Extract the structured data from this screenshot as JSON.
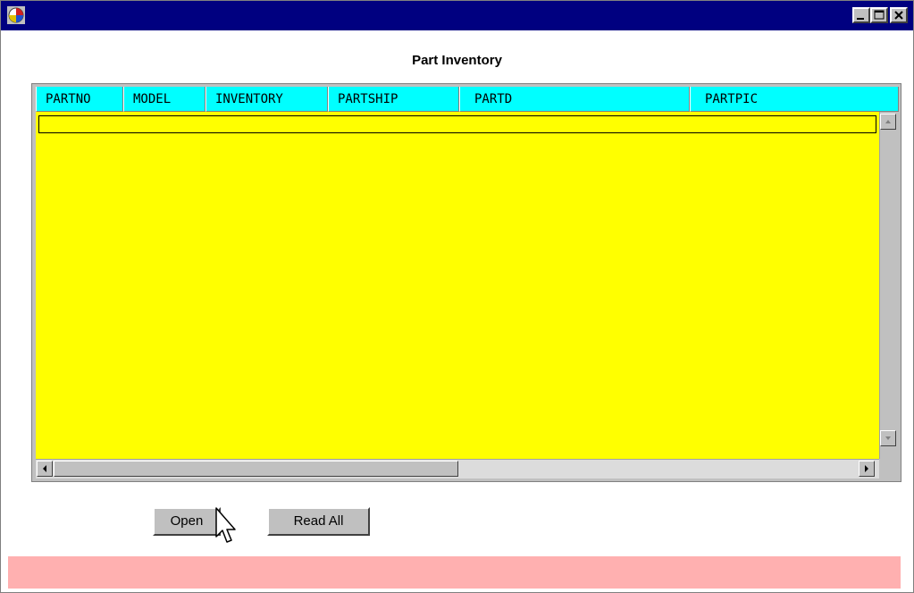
{
  "window": {
    "title": "",
    "controls": [
      "minimize-icon",
      "maximize-icon",
      "close-icon"
    ]
  },
  "heading": "Part Inventory",
  "table": {
    "columns": [
      "PARTNO",
      "MODEL",
      "INVENTORY",
      "PARTSHIP",
      "PARTD",
      "PARTPIC"
    ],
    "rows": [],
    "background": "#ffff00",
    "header_background": "#00ffff"
  },
  "buttons": {
    "open": "Open",
    "read_all": "Read All"
  },
  "status_bar": {
    "text": "",
    "color": "#ffb0b0"
  },
  "colors": {
    "titlebar": "#000080",
    "button_face": "#c0c0c0"
  }
}
